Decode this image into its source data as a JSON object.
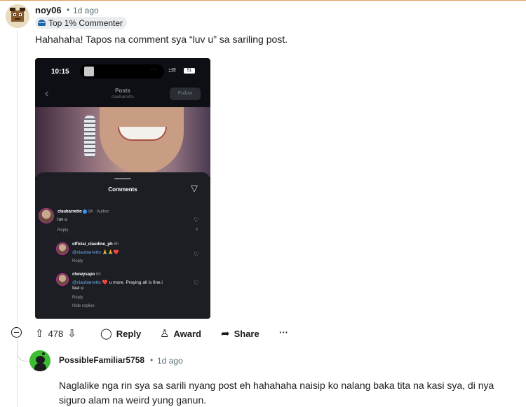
{
  "comment": {
    "username": "noy06",
    "separator": "•",
    "time": "1d ago",
    "flair": "Top 1% Commenter",
    "body": "Hahahaha! Tapos na comment sya “luv u” sa sariling post.",
    "vote_count": "478",
    "actions": {
      "reply": "Reply",
      "award": "Award",
      "share": "Share",
      "more": "···"
    }
  },
  "screenshot": {
    "status_time": "10:15",
    "status_signal": "::!!",
    "status_battery": "51",
    "island_text": "···",
    "nav_title": "Posts",
    "nav_subtitle": "claubarretto",
    "follow_label": "Follow",
    "sheet_title": "Comments",
    "comments": [
      {
        "user": "claubarretto",
        "meta": "8h · Author",
        "text": "luv u",
        "reply": "Reply",
        "likes": "9"
      },
      {
        "user": "official_claudine_ph",
        "meta": "6h",
        "mention": "@claubarretto",
        "emoji": " 🙏🙏❤️",
        "reply": "Reply"
      },
      {
        "user": "chewysapo",
        "meta": "6h",
        "mention": "@claubarretto",
        "text_line1": " ❤️ u more. Praying all is fine.i",
        "text_line2": "feel u",
        "reply": "Reply"
      }
    ],
    "hide_replies": "Hide replies"
  },
  "reply": {
    "username": "PossibleFamiliar5758",
    "separator": "•",
    "time": "1d ago",
    "body": "Naglalike nga rin sya sa sarili nyang post eh hahahaha naisip ko nalang baka tita na kasi sya, di nya siguro alam na weird yung ganun."
  },
  "colors": {
    "mention": "#6fa8e8",
    "flair_icon": "#1f64a8",
    "reply_avatar": "#3bbd34"
  }
}
